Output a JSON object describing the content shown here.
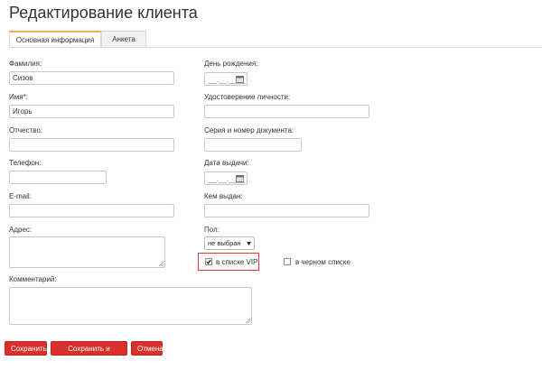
{
  "page": {
    "title": "Редактирование клиента"
  },
  "tabs": [
    {
      "label": "Основная информация",
      "active": true
    },
    {
      "label": "Анкета",
      "active": false
    }
  ],
  "form": {
    "last_name": {
      "label": "Фамилия:",
      "value": "Сизов"
    },
    "first_name": {
      "label": "Имя*:",
      "value": "Игорь"
    },
    "middle_name": {
      "label": "Отчество:",
      "value": ""
    },
    "phone": {
      "label": "Телефон:",
      "value": ""
    },
    "email": {
      "label": "E-mail:",
      "value": ""
    },
    "address": {
      "label": "Адрес:",
      "value": ""
    },
    "comment": {
      "label": "Комментарий:",
      "value": ""
    },
    "birthday": {
      "label": "День рождения:",
      "placeholder": "__.__.____"
    },
    "id_document": {
      "label": "Удостоверение личности:",
      "value": ""
    },
    "doc_series_number": {
      "label": "Серия и номер документа:",
      "value": ""
    },
    "issue_date": {
      "label": "Дата выдачи:",
      "placeholder": "__.__.____"
    },
    "issued_by": {
      "label": "Кем выдан:",
      "value": ""
    },
    "gender": {
      "label": "Пол:",
      "selected": "не выбран"
    },
    "vip": {
      "label": "в списке VIP",
      "checked": true
    },
    "blacklist": {
      "label": "в черном списке",
      "checked": false
    }
  },
  "buttons": {
    "save": "Сохранить",
    "save_stay": "Сохранить и остаться",
    "cancel": "Отмена"
  },
  "colors": {
    "button_red": "#d9302c",
    "highlight": "#e53935",
    "tab_accent": "#f0ad4e"
  }
}
